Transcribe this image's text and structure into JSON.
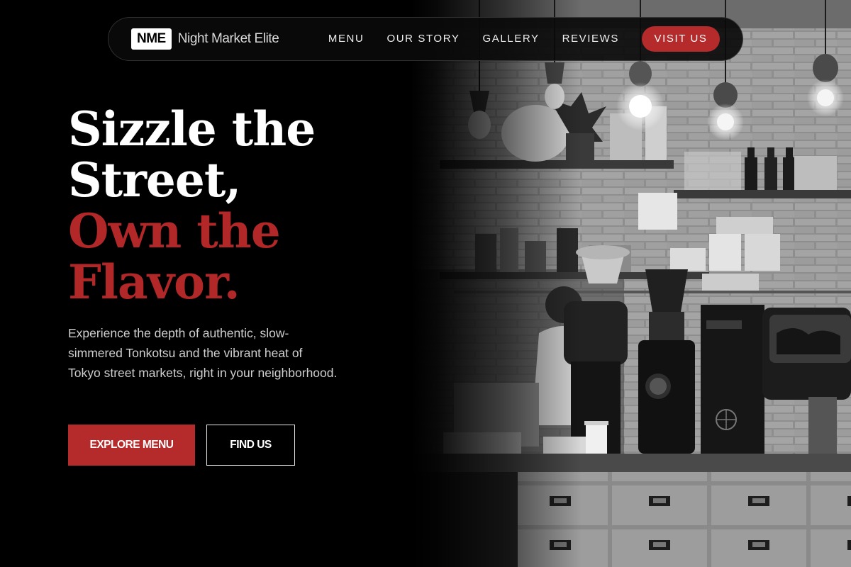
{
  "brand": {
    "mark": "NME",
    "name": "Night Market Elite"
  },
  "nav": {
    "items": [
      {
        "label": "MENU"
      },
      {
        "label": "OUR STORY"
      },
      {
        "label": "GALLERY"
      },
      {
        "label": "REVIEWS"
      }
    ],
    "cta_label": "VISIT US"
  },
  "hero": {
    "title_lines": [
      "Sizzle the",
      "Street,"
    ],
    "accent_lines": [
      "Own the",
      "Flavor."
    ],
    "description": "Experience the depth of authentic, slow-simmered Tonkotsu and the vibrant heat of Tokyo street markets, right in your neighborhood.",
    "primary_button": "EXPLORE MENU",
    "secondary_button": "FIND US",
    "image_description_icon": "cafe-interior-photo"
  },
  "colors": {
    "accent": "#b52a2a",
    "background": "#000000",
    "text": "#ffffff",
    "muted_text": "#cfcfcf"
  }
}
